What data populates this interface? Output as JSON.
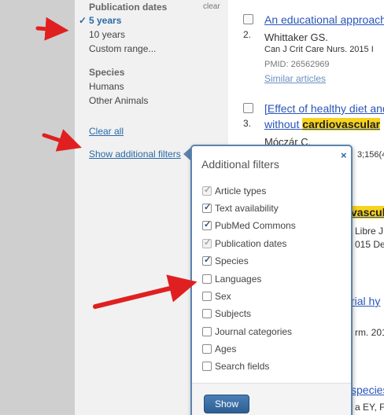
{
  "sidebar": {
    "section_title": "Publication dates",
    "clear_label": "clear",
    "date_options": [
      "5 years",
      "10 years",
      "Custom range..."
    ],
    "species_title": "Species",
    "species_options": [
      "Humans",
      "Other Animals"
    ],
    "clear_all_label": "Clear all",
    "show_filters_label": "Show additional filters"
  },
  "results": {
    "item1": {
      "title": "An educational approach",
      "number": "2.",
      "authors": "Whittaker GS.",
      "journal": "Can J Crit Care Nurs. 2015 I",
      "pmid": "PMID: 26562969",
      "similar": "Similar articles"
    },
    "item2": {
      "number": "3.",
      "title_line1": "[Effect of healthy diet and",
      "title_line2_pre": "without ",
      "title_line2_hl": "cardiovascular",
      "authors": "Móczár C.",
      "journal_frag": "3;156(4"
    },
    "fragments": {
      "hl_frag": "vascular",
      "libre": "Libre J",
      "year": "015 De",
      "rial": "rial hy",
      "frm": "rm. 201",
      "species_frag": "species",
      "ey": "a EY, F"
    }
  },
  "popup": {
    "title": "Additional filters",
    "close": "×",
    "filters": [
      {
        "label": "Article types",
        "checked": true,
        "disabled": true
      },
      {
        "label": "Text availability",
        "checked": true,
        "disabled": false
      },
      {
        "label": "PubMed Commons",
        "checked": true,
        "disabled": false
      },
      {
        "label": "Publication dates",
        "checked": true,
        "disabled": true
      },
      {
        "label": "Species",
        "checked": true,
        "disabled": false
      },
      {
        "label": "Languages",
        "checked": false,
        "disabled": false
      },
      {
        "label": "Sex",
        "checked": false,
        "disabled": false
      },
      {
        "label": "Subjects",
        "checked": false,
        "disabled": false
      },
      {
        "label": "Journal categories",
        "checked": false,
        "disabled": false
      },
      {
        "label": "Ages",
        "checked": false,
        "disabled": false
      },
      {
        "label": "Search fields",
        "checked": false,
        "disabled": false
      }
    ],
    "show_label": "Show"
  },
  "colors": {
    "link": "#2a6aa6",
    "highlight": "#f7d31d",
    "arrow": "#e02020",
    "popup_border": "#5b84ad"
  }
}
